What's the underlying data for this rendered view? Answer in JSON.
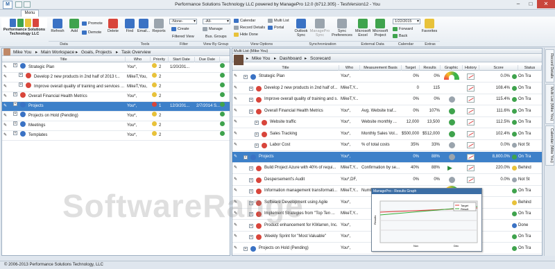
{
  "window": {
    "title": "Performance Solutions Technology LLC powered by ManagePro 12.0 (b712.305) - TestVersion12 - You"
  },
  "menu_tab": "Menu",
  "ribbon": {
    "company": "Performance Solutions Technology LLC",
    "buttons": {
      "refresh": "Refresh",
      "add": "Add",
      "promote": "Promote",
      "demote": "Demote",
      "delete": "Delete",
      "find": "Find",
      "email": "Email...",
      "reports": "Reports",
      "create": "Create",
      "manage": "Manage",
      "calendar": "Calendar",
      "record_details": "Record Details",
      "hide_done": "Hide Done",
      "multi_list": "Multi List",
      "portal": "Portal",
      "outlook_sync": "Outlook Sync",
      "managepro_sync": "ManagePro Sync",
      "sync_preferences": "Sync Preferences",
      "microsoft_excel": "Microsoft Excel",
      "microsoft_project": "Microsoft Project",
      "forward": "Forward",
      "back": "Back",
      "favorites": "Favorites"
    },
    "combos": {
      "filter": "-None-",
      "group": "-All-",
      "date": "1/22/2015"
    },
    "groups": [
      "Data",
      "Tools",
      "Filter",
      "View By Group",
      "View Options",
      "Synchronization",
      "External Data",
      "Calendar",
      "Extras"
    ],
    "group_sub": {
      "filtered_view": "Filtered View",
      "bus_groups": "Bus. Groups"
    }
  },
  "left": {
    "breadcrumb": [
      "Mike You",
      "Main Workspace",
      "Goals, Projects",
      "Task Overview"
    ],
    "columns": [
      "Title",
      "Who",
      "Priority",
      "Start Date",
      "Due Date"
    ],
    "rows": [
      {
        "title": "Strategic Plan",
        "who": "You*,",
        "priority": "2",
        "start": "1/20/201...",
        "due": ""
      },
      {
        "title": "Develop 2 new products in 2nd half of 2013 t...",
        "who": "MikeT,You,",
        "priority": "2",
        "start": "",
        "due": ""
      },
      {
        "title": "Improve overall quality of training and services ...",
        "who": "MikeT,You,",
        "priority": "2",
        "start": "",
        "due": ""
      },
      {
        "title": "Overall Financial Health Metrics",
        "who": "You*,",
        "priority": "2",
        "start": "",
        "due": ""
      },
      {
        "title": "Projects",
        "who": "You*,",
        "priority": "1",
        "start": "12/3/201...",
        "due": "2/7/2014 S..."
      },
      {
        "title": "Projects on Hold (Pending)",
        "who": "You*,",
        "priority": "2",
        "start": "",
        "due": ""
      },
      {
        "title": "Meetings",
        "who": "You*,",
        "priority": "2",
        "start": "",
        "due": ""
      },
      {
        "title": "Templates",
        "who": "You*,",
        "priority": "2",
        "start": "",
        "due": ""
      }
    ]
  },
  "right": {
    "pane_label": "Multi List (Mike You)",
    "breadcrumb": [
      "Mike You",
      "Dashboard",
      "Scorecard"
    ],
    "columns": [
      "Title",
      "Who",
      "Measurement Basis",
      "Target",
      "Results",
      "Graphic",
      "History",
      "Score",
      "Status"
    ],
    "rows": [
      {
        "title": "Strategic Plan",
        "who": "You*,",
        "basis": "",
        "target": "0%",
        "results": "0%",
        "score": "0.0%",
        "status": "On Tra"
      },
      {
        "title": "Develop 2 new products in 2nd half of...",
        "who": "MikeT,Y...",
        "basis": "",
        "target": "0",
        "results": "115",
        "score": "108.4%",
        "status": "On Tra"
      },
      {
        "title": "Improve overall quality of training and s...",
        "who": "MikeT,Y...",
        "basis": "",
        "target": "0%",
        "results": "0%",
        "score": "115.4%",
        "status": "On Tra"
      },
      {
        "title": "Overall Financial Health Metrics",
        "who": "You*,",
        "basis": "Avg. Website traf...",
        "target": "0%",
        "results": "107%",
        "score": "111.6%",
        "status": "On Tra"
      },
      {
        "title": "Website traffic",
        "who": "You*,",
        "basis": "Website monthly ...",
        "target": "12,000",
        "results": "13,500",
        "score": "112.5%",
        "status": "On Tra"
      },
      {
        "title": "Sales Tracking",
        "who": "You*,",
        "basis": "Monthly Sales Vol...",
        "target": "$500,000",
        "results": "$512,000",
        "score": "102.4%",
        "status": "On Tra"
      },
      {
        "title": "Labor Cost",
        "who": "You*,",
        "basis": "% of total costs",
        "target": "35%",
        "results": "33%",
        "score": "0.0%",
        "status": "Not St"
      },
      {
        "title": "Projects",
        "who": "You*,",
        "basis": "",
        "target": "0%",
        "results": "88%",
        "score": "8,800.0%",
        "status": "On Tra"
      },
      {
        "title": "Build Project  Azure with 40% of requi...",
        "who": "MikeT,Y...",
        "basis": "Confirmation by se...",
        "target": "40%",
        "results": "88%",
        "score": "220.0%",
        "status": "Behind"
      },
      {
        "title": "Despersement's Audit",
        "who": "You*,DF,",
        "basis": "",
        "target": "0%",
        "results": "0%",
        "score": "0.0%",
        "status": "Not St"
      },
      {
        "title": "Information management transformati...",
        "who": "MikeT,Y...",
        "basis": "Number of monthl...",
        "target": "15,000",
        "results": "15,800",
        "score": "",
        "status": "On Tra"
      },
      {
        "title": "Software Development using Agile",
        "who": "You*,",
        "basis": "",
        "target": "",
        "results": "",
        "score": "",
        "status": "Behind"
      },
      {
        "title": "Implement Strategies from \"Top Ten ...",
        "who": "MikeT,Y...",
        "basis": "",
        "target": "",
        "results": "",
        "score": "",
        "status": "On Tra"
      },
      {
        "title": "Product enhancement for KWarren, Inc.",
        "who": "You*,",
        "basis": "",
        "target": "",
        "results": "",
        "score": "",
        "status": "Done"
      },
      {
        "title": "Weekly Sprint for \"Most Valuable\"",
        "who": "You*,",
        "basis": "",
        "target": "",
        "results": "",
        "score": "",
        "status": "On Tra"
      },
      {
        "title": "Projects on Hold (Pending)",
        "who": "You*,",
        "basis": "",
        "target": "",
        "results": "",
        "score": "",
        "status": "On Tra"
      }
    ]
  },
  "side_tabs": [
    "Record Details",
    "Multi List (Mike You)",
    "Calendar (Mike You)"
  ],
  "popup": {
    "title": "ManagePro - Results Graph",
    "legend": [
      "Target",
      "Result"
    ],
    "yaxis": "Results",
    "x_ticks": [
      "Nov",
      "Dec"
    ]
  },
  "status": {
    "copyright": "© 2006-2013 Performance Solutions Technology, LLC"
  },
  "watermark": "SoftwareRange",
  "colors": {
    "selection": "#3d80c9",
    "accent": "#2b64a6"
  }
}
